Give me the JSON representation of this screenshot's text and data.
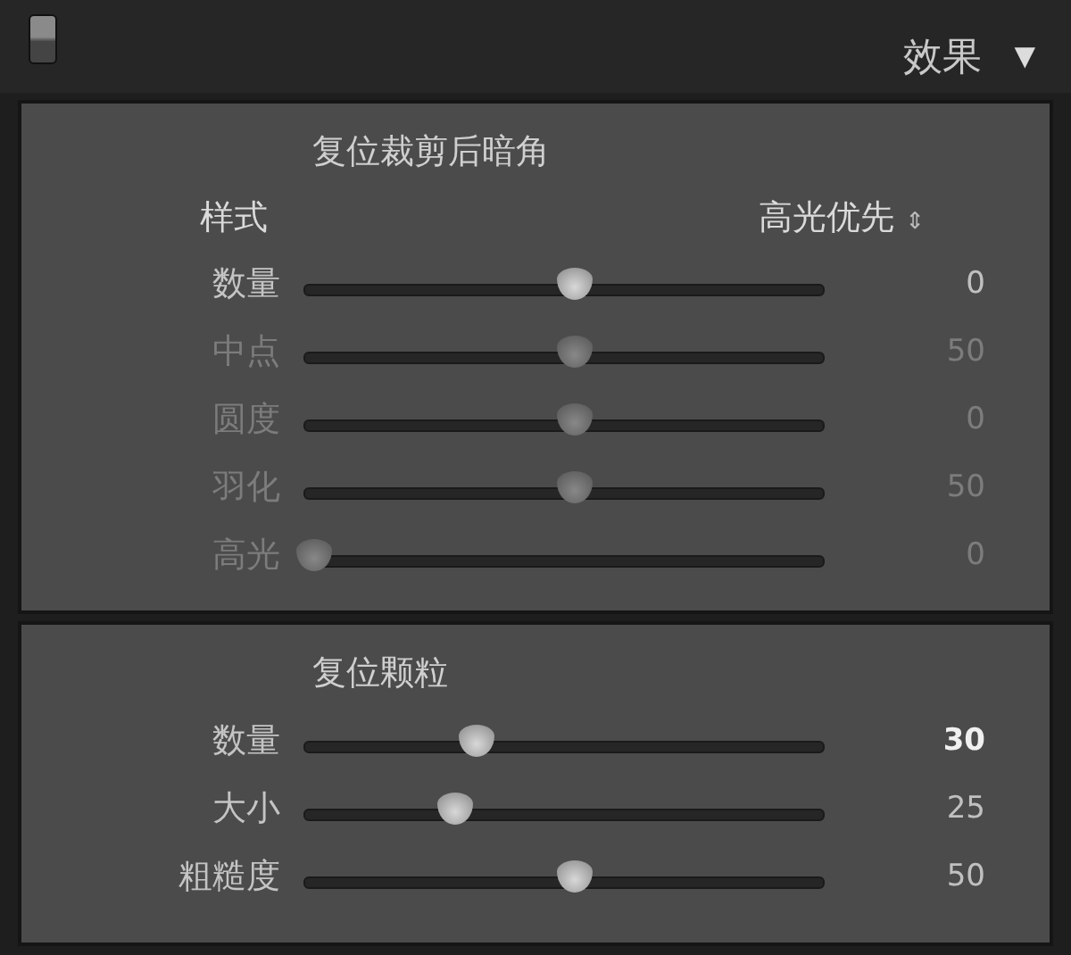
{
  "header": {
    "title": "效果",
    "collapse_glyph": "▼"
  },
  "sections": [
    {
      "title": "复位裁剪后暗角",
      "style": {
        "label": "样式",
        "value": "高光优先",
        "glyph": "⇕"
      },
      "sliders": [
        {
          "label": "数量",
          "level": 0.5,
          "reading": "0",
          "disabled": false,
          "active": false
        },
        {
          "label": "中点",
          "level": 0.5,
          "reading": "50",
          "disabled": true,
          "active": false
        },
        {
          "label": "圆度",
          "level": 0.5,
          "reading": "0",
          "disabled": true,
          "active": false
        },
        {
          "label": "羽化",
          "level": 0.5,
          "reading": "50",
          "disabled": true,
          "active": false
        },
        {
          "label": "高光",
          "level": 0.02,
          "reading": "0",
          "disabled": true,
          "active": false
        }
      ]
    },
    {
      "title": "复位颗粒",
      "sliders": [
        {
          "label": "数量",
          "level": 0.32,
          "reading": "30",
          "disabled": false,
          "active": true
        },
        {
          "label": "大小",
          "level": 0.28,
          "reading": "25",
          "disabled": false,
          "active": false
        },
        {
          "label": "粗糙度",
          "level": 0.5,
          "reading": "50",
          "disabled": false,
          "active": false
        }
      ]
    }
  ]
}
